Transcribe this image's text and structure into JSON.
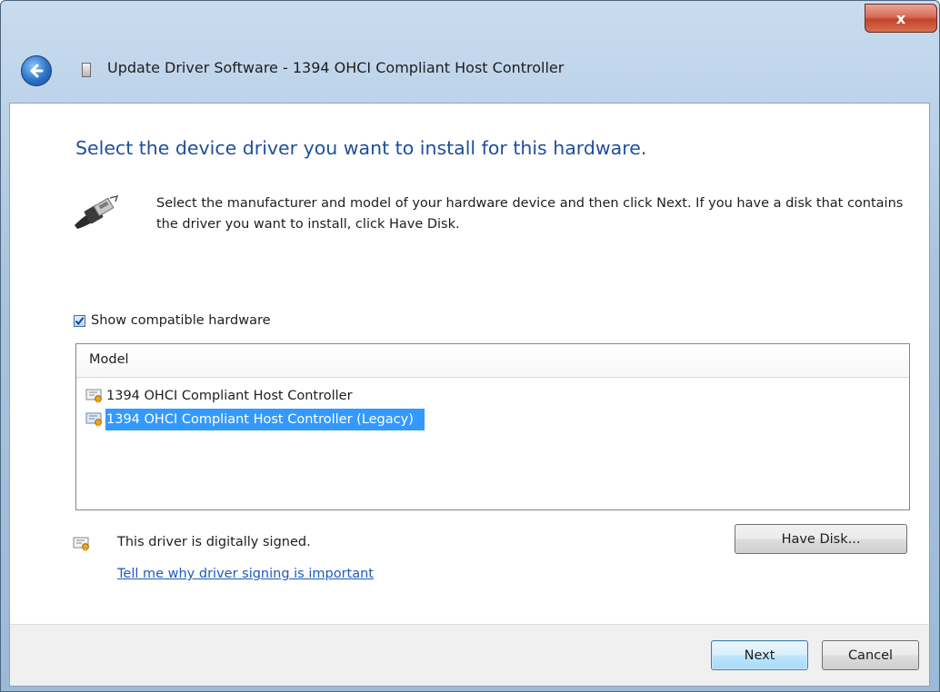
{
  "window": {
    "title": "Update Driver Software - 1394 OHCI Compliant Host Controller",
    "close_glyph": "x"
  },
  "wizard": {
    "heading": "Select the device driver you want to install for this hardware.",
    "instructions": "Select the manufacturer and model of your hardware device and then click Next. If you have a disk that contains the driver you want to install, click Have Disk.",
    "show_compatible": {
      "label": "Show compatible hardware",
      "checked": true
    },
    "list": {
      "column_header": "Model",
      "items": [
        {
          "label": "1394 OHCI Compliant Host Controller",
          "selected": false
        },
        {
          "label": "1394 OHCI Compliant Host Controller (Legacy)",
          "selected": true
        }
      ]
    },
    "signature": {
      "status": "This driver is digitally signed.",
      "link": "Tell me why driver signing is important"
    },
    "have_disk_label": "Have Disk..."
  },
  "footer": {
    "next_label": "Next",
    "cancel_label": "Cancel"
  },
  "colors": {
    "heading": "#1f4f9b",
    "selection": "#3399ff",
    "link": "#1c5bbd"
  }
}
